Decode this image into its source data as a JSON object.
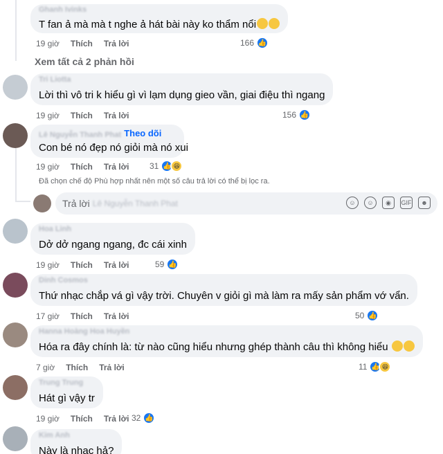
{
  "comments": [
    {
      "author": "Ghanh Ivinks",
      "text": "T fan ả mà mà t nghe ả hát bài này ko thẩm nổi",
      "emoji": "😮‍💨😮‍💨",
      "time": "19 giờ",
      "like": "Thích",
      "reply": "Trả lời",
      "count": "166",
      "reactions": [
        "like-icon"
      ]
    },
    {
      "author": "Tri Liotta",
      "text": "Lời thì vô tri k hiểu gì vì lạm dụng gieo vần, giai điệu thì ngang",
      "time": "19 giờ",
      "like": "Thích",
      "reply": "Trả lời",
      "count": "156",
      "reactions": [
        "like-icon"
      ]
    },
    {
      "author": "Lê Nguyễn Thanh Phat",
      "follow": "Theo dõi",
      "text": "Con bé nó đẹp nó giỏi mà nó xui",
      "time": "19 giờ",
      "like": "Thích",
      "reply": "Trả lời",
      "count": "31",
      "reactions": [
        "like-icon",
        "haha-icon"
      ]
    },
    {
      "author": "Hoa Linh",
      "text": "Dở dở ngang ngang, đc cái xinh",
      "time": "19 giờ",
      "like": "Thích",
      "reply": "Trả lời",
      "count": "59",
      "reactions": [
        "like-icon"
      ]
    },
    {
      "author": "Dinh Cosmos",
      "text": "Thứ nhạc chắp vá gì vậy trời. Chuyên v giỏi gì mà làm ra mấy sản phẩm vớ vẩn.",
      "time": "17 giờ",
      "like": "Thích",
      "reply": "Trả lời",
      "count": "50",
      "reactions": [
        "like-icon"
      ]
    },
    {
      "author": "Hanna Hoàng Hoa Huyền",
      "text": "Hóa ra đây chính là: từ nào cũng hiểu nhưng ghép thành câu thì không hiểu",
      "emoji": "🤓🤓",
      "time": "7 giờ",
      "like": "Thích",
      "reply": "Trả lời",
      "count": "11",
      "reactions": [
        "like-icon",
        "haha-icon"
      ]
    },
    {
      "author": "Trung Trung",
      "text": "Hát gì vậy tr",
      "time": "19 giờ",
      "like": "Thích",
      "reply": "Trả lời",
      "count": "32",
      "reactions": [
        "like-icon"
      ]
    },
    {
      "author": "Kim Anh",
      "text": "Này là nhạc hả?"
    }
  ],
  "view_replies": "Xem tất cả 2 phản hồi",
  "filter_note": "Đã chọn chế độ Phù hợp nhất nên một số câu trả lời có thể bị lọc ra.",
  "reply_box": {
    "placeholder": "Trả lời",
    "name": "Lê Nguyễn Thanh Phat"
  },
  "reply_tools": [
    "sticker-icon",
    "emoji-icon",
    "camera-icon",
    "gif-icon",
    "stickers-icon"
  ],
  "colors": {
    "bubble": "#f0f2f5",
    "link": "#0866ff",
    "like": "#1877f2",
    "meta": "#65676b"
  }
}
